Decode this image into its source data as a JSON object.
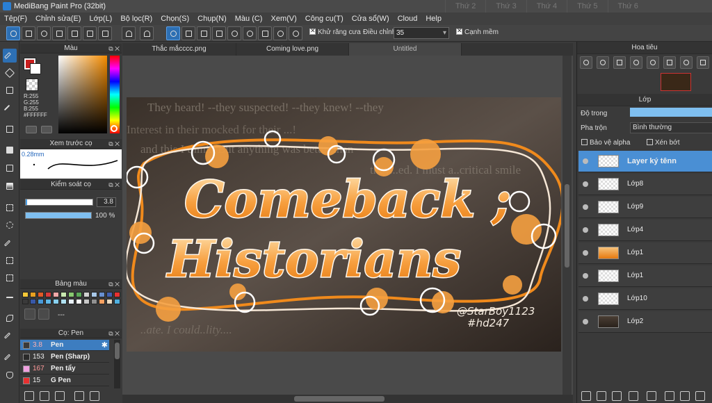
{
  "window": {
    "title": "MediBang Paint Pro (32bit)",
    "ghost_tabs": [
      "Thứ 2",
      "Thứ 3",
      "Thứ 4",
      "Thứ 5",
      "Thứ 6"
    ]
  },
  "menu": [
    "Tệp(F)",
    "Chỉnh sửa(E)",
    "Lớp(L)",
    "Bộ lọc(R)",
    "Chọn(S)",
    "Chụp(N)",
    "Màu (C)",
    "Xem(V)",
    "Công cụ(T)",
    "Cửa sổ(W)",
    "Cloud",
    "Help"
  ],
  "toolbar": {
    "antialias_label": "Khử răng cưa",
    "correction_label": "Điều chỉnh",
    "correction_value": "35",
    "snap_label": "Cạnh mềm"
  },
  "color_panel": {
    "title": "Màu",
    "r": "R:255",
    "g": "G:255",
    "b": "B:255",
    "hex": "#FFFFFF",
    "fg_color": "#c81e1e"
  },
  "preview_panel": {
    "title": "Xem trước cọ",
    "size": "0.28mm"
  },
  "control_panel": {
    "title": "Kiểm soát cọ",
    "size_value": "3.8",
    "opacity_value": "100 %"
  },
  "palette_panel": {
    "title": "Bảng màu",
    "dash": "---",
    "swatches": [
      "#f5c838",
      "#e8a020",
      "#e05a28",
      "#d83a3a",
      "#f0a8a8",
      "#c8e8b0",
      "#88c870",
      "#5aa858",
      "#d0d0d0",
      "#a8c8e8",
      "#6890d0",
      "#4060b0",
      "#e83030",
      "#3a3a3a",
      "#3858a8",
      "#4898d8",
      "#60b8e8",
      "#88d0f0",
      "#b0e0f0",
      "#e8f0f8",
      "#f8f8f8",
      "#c8c8c8",
      "#909090",
      "#f8a060",
      "#e8d8c0",
      "#50b0e0"
    ]
  },
  "pen_panel": {
    "title": "Cọ: Pen",
    "items": [
      {
        "num": "3.8",
        "name": "Pen",
        "color": "#3a3a3a"
      },
      {
        "num": "153",
        "name": "Pen (Sharp)",
        "color": "#2a2a2a"
      },
      {
        "num": "167",
        "name": "Pen tẩy",
        "color": "#f0a0e0"
      },
      {
        "num": "15",
        "name": "G Pen",
        "color": "#e83030"
      }
    ]
  },
  "tabs": [
    "Thắc mắcccc.png",
    "Coming love.png",
    "Untitled"
  ],
  "artwork": {
    "line1": "Comeback ;",
    "line2": "Historians",
    "signature": "@StarBoy1123",
    "tag": "#hd247",
    "bg_text": [
      "They heard! --they suspected! --they knew! --they",
      "Interest in their mocked for their ...!",
      "and this I think. But anything was better than",
      "they...ed. I must a..critical smile",
      "..ate. I could..lity...."
    ]
  },
  "navigator": {
    "title": "Hoa tiêu"
  },
  "layer_panel": {
    "title": "Lớp",
    "opacity_label": "Độ trong",
    "blend_label": "Pha trộn",
    "blend_value": "Bình thường",
    "protect_alpha_label": "Bảo vệ alpha",
    "clip_label": "Xén bớt",
    "layers": [
      {
        "name": "Layer ký tênn",
        "thumb": "blank"
      },
      {
        "name": "Lớp8",
        "thumb": "blank"
      },
      {
        "name": "Lớp9",
        "thumb": "blank"
      },
      {
        "name": "Lớp4",
        "thumb": "blank"
      },
      {
        "name": "Lớp1",
        "thumb": "art"
      },
      {
        "name": "Lớp1",
        "thumb": "blank"
      },
      {
        "name": "Lớp10",
        "thumb": "blank"
      },
      {
        "name": "Lớp2",
        "thumb": "photo"
      }
    ]
  }
}
